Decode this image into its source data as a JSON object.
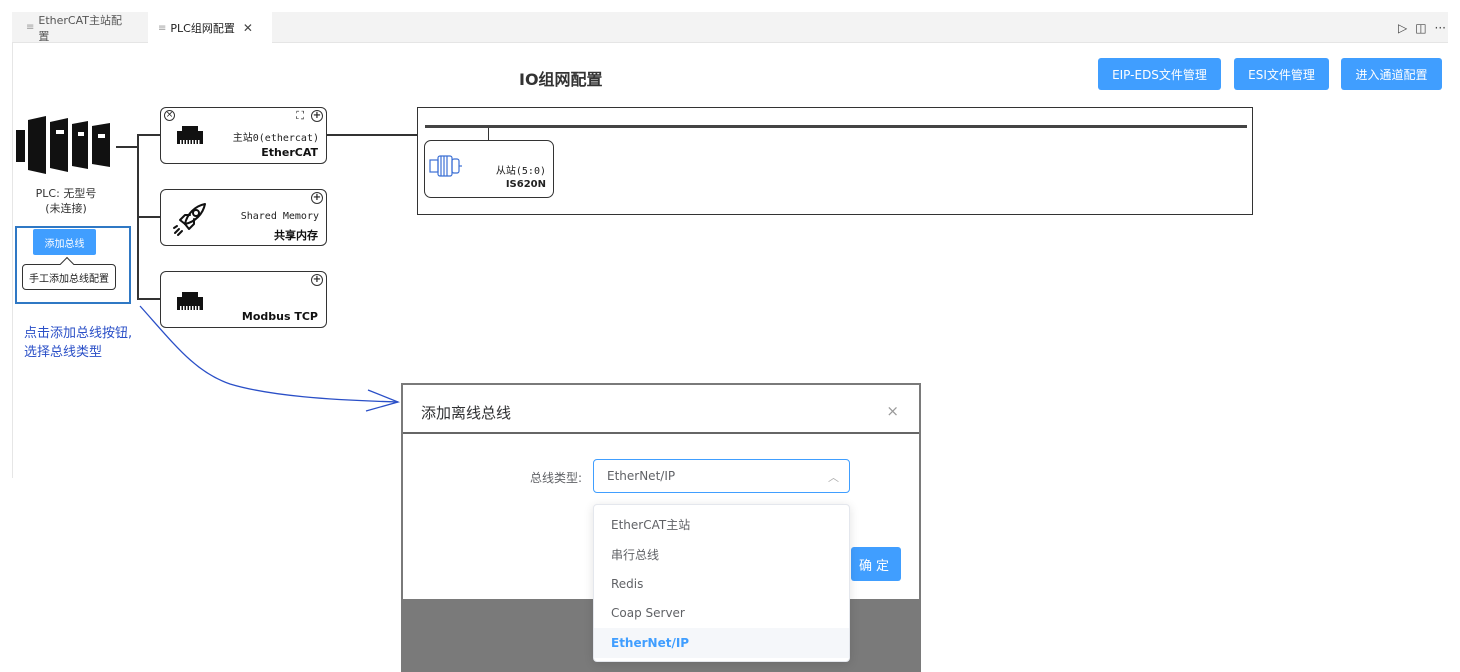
{
  "tabs": [
    {
      "label": "EtherCAT主站配置",
      "active": false
    },
    {
      "label": "PLC组网配置",
      "active": true
    }
  ],
  "tab_actions": [
    "▷",
    "◫",
    "···"
  ],
  "page_title": "IO组网配置",
  "buttons": {
    "eip_eds": "EIP-EDS文件管理",
    "esi": "ESI文件管理",
    "channel": "进入通道配置"
  },
  "plc": {
    "label_line1": "PLC: 无型号",
    "label_line2": "(未连接)",
    "add_bus_button": "添加总线",
    "tooltip": "手工添加总线配置"
  },
  "annotation": {
    "line1": "点击添加总线按钮,",
    "line2": "选择总线类型"
  },
  "buses": [
    {
      "name": "主站0(ethercat)",
      "type": "EtherCAT"
    },
    {
      "name": "Shared Memory",
      "type": "共享内存"
    },
    {
      "name": "",
      "type": "Modbus TCP"
    }
  ],
  "slave": {
    "name": "从站(5:0)",
    "model": "IS620N"
  },
  "dialog": {
    "title": "添加离线总线",
    "close": "×",
    "field_label": "总线类型:",
    "selected_value": "EtherNet/IP",
    "confirm": "确定",
    "options": [
      "EtherCAT主站",
      "串行总线",
      "Redis",
      "Coap Server",
      "EtherNet/IP"
    ]
  },
  "colors": {
    "accent": "#409eff",
    "annotation": "#2a4fc7",
    "highlight_box": "#2f78c4"
  }
}
